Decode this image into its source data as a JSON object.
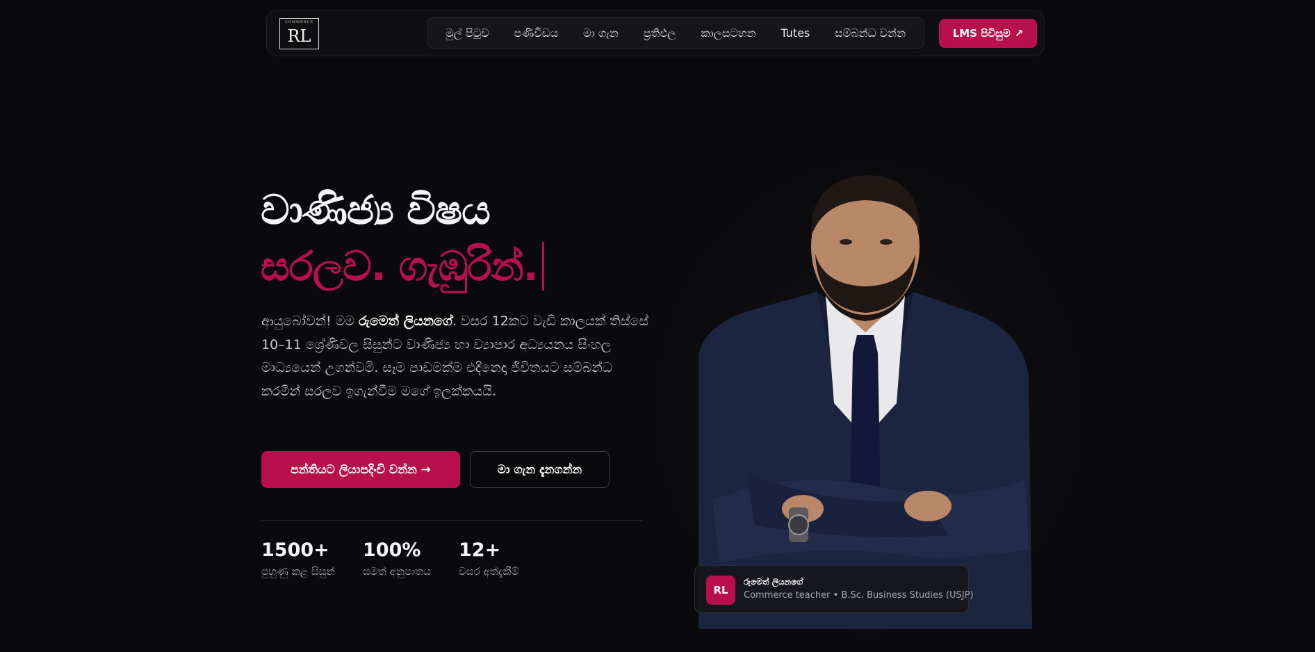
{
  "nav": {
    "logo": {
      "top_text": "COMMERCE",
      "mark": "RL"
    },
    "menu": [
      {
        "label": "මුල් පිටුව"
      },
      {
        "label": "පණිවිඩය"
      },
      {
        "label": "මා ගැන"
      },
      {
        "label": "ප්‍රතිඵල"
      },
      {
        "label": "කාලසටහන"
      },
      {
        "label": "Tutes"
      },
      {
        "label": "සම්බන්ධ වන්න"
      }
    ],
    "lms_button": {
      "label": "LMS පිවිසුම",
      "icon": "↗"
    }
  },
  "hero": {
    "title_line1": "වාණිජ්‍ය විෂය",
    "title_line2": "සරලව. ගැඹුරින්.",
    "intro_prefix": "ආයුබෝවන්! මම ",
    "intro_name": "රුමෙත් ලියනගේ",
    "intro_suffix": ". වසර 12කට වැඩි කාලයක් තිස්සේ 10–11 ශ්‍රේණිවල සිසුන්ට වාණිජ්‍ය හා ව්‍යාපාර අධ්‍යයනය සිංහල මාධ්‍යයෙන් උගන්වමි. සෑම පාඩමක්ම එදිනෙදා ජීවිතයට සම්බන්ධ කරමින් සරලව ඉගැන්වීම මගේ ඉලක්කයයි.",
    "primary_button": "පන්තියට ලියාපදිංචි වන්න →",
    "secondary_button": "මා ගැන දැනගන්න",
    "stats": [
      {
        "value": "1500+",
        "label": "පුහුණු කළ සිසුන්"
      },
      {
        "value": "100%",
        "label": "සමත් අනුපාතය"
      },
      {
        "value": "12+",
        "label": "වසර අත්දැකීම්"
      }
    ]
  },
  "profile_card": {
    "initials": "RL",
    "name": "රුමෙත් ලියනගේ",
    "role": "Commerce teacher • B.Sc. Business Studies (USJP)"
  },
  "colors": {
    "accent": "#b8104b",
    "background": "#0a0a0c",
    "suit": "#1c2540"
  }
}
